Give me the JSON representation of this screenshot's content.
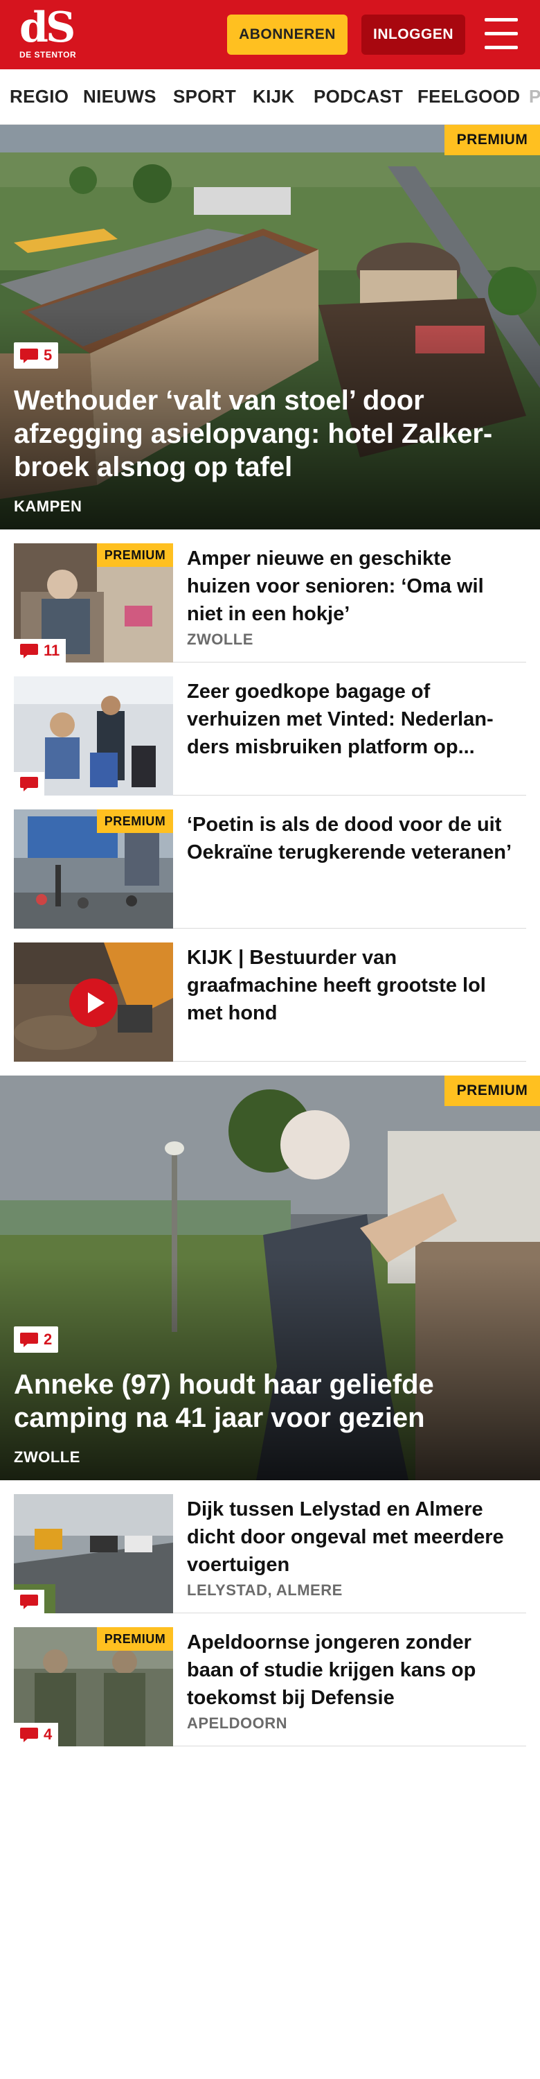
{
  "header": {
    "logo_mark": "dS",
    "logo_sub": "DE STENTOR",
    "subscribe_label": "ABONNEREN",
    "login_label": "INLOGGEN",
    "brand_color": "#d6141e",
    "accent_color": "#ffc020",
    "menu_icon": "hamburger-menu-icon"
  },
  "nav": {
    "items": [
      "REGIO",
      "NIEUWS",
      "SPORT",
      "KIJK",
      "PODCAST",
      "FEELGOOD",
      "P"
    ]
  },
  "hero1": {
    "premium": "PREMIUM",
    "comments": "5",
    "title": "Wethouder ‘valt van stoel’ door afzegging asielopvang: hotel Zalker­broek alsnog op tafel",
    "tag": "KAMPEN"
  },
  "articles": [
    {
      "premium": "PREMIUM",
      "comments": "11",
      "title": "Amper nieuwe en geschikte huizen voor senioren: ‘Oma wil niet in een hokje’",
      "tag": "ZWOLLE"
    },
    {
      "premium": "",
      "comments": "",
      "title": "Zeer goedkope bagage of verhuizen met Vinted: Nederlan­ders misbruiken platform op...",
      "tag": ""
    },
    {
      "premium": "PREMIUM",
      "comments": "",
      "title": "‘Poetin is als de dood voor de uit Oekraïne terugkerende veteranen’",
      "tag": ""
    },
    {
      "premium": "",
      "comments": "",
      "title": "KIJK | Bestuurder van graafmachine heeft grootste lol met hond",
      "tag": ""
    }
  ],
  "hero2": {
    "premium": "PREMIUM",
    "comments": "2",
    "title": "Anneke (97) houdt haar geliefde camping na 41 jaar voor gezien",
    "tag": "ZWOLLE"
  },
  "articles2": [
    {
      "premium": "",
      "comments": "",
      "title": "Dijk tussen Lelystad en Almere dicht door ongeval met meerdere voertuigen",
      "tag": "LELYSTAD, ALMERE"
    },
    {
      "premium": "PREMIUM",
      "comments": "4",
      "title": "Apeldoornse jongeren zonder baan of studie krijgen kans op toekomst bij Defensie",
      "tag": "APELDOORN"
    }
  ]
}
